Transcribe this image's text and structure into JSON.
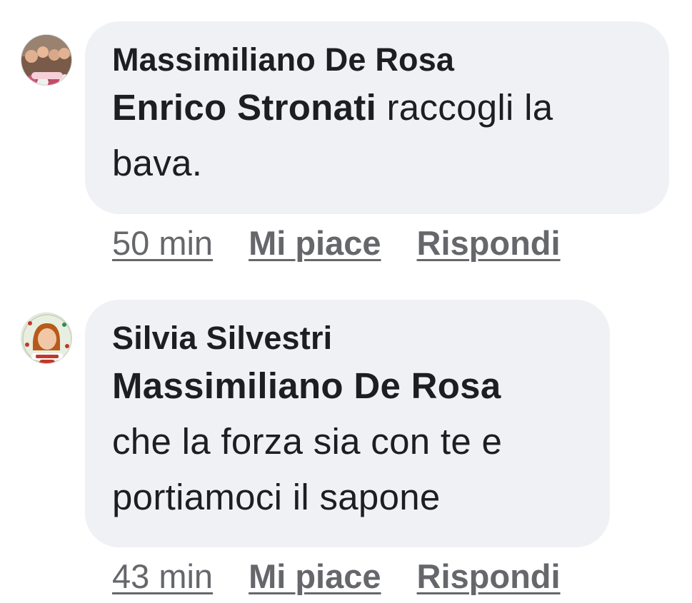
{
  "comments": [
    {
      "author": "Massimiliano De Rosa",
      "mention": "Enrico Stronati",
      "text": " raccogli la bava.",
      "time": "50 min",
      "like_label": "Mi piace",
      "reply_label": "Rispondi",
      "avatar_icon": "group-photo-avatar"
    },
    {
      "author": "Silvia Silvestri",
      "mention": "Massimiliano De Rosa",
      "text": "che la forza sia con te e portiamoci il sapone",
      "time": "43 min",
      "like_label": "Mi piace",
      "reply_label": "Rispondi",
      "avatar_icon": "portrait-avatar"
    }
  ],
  "colors": {
    "bubble": "#f0f1f4",
    "text": "#1c1e21",
    "meta": "#65676b"
  }
}
